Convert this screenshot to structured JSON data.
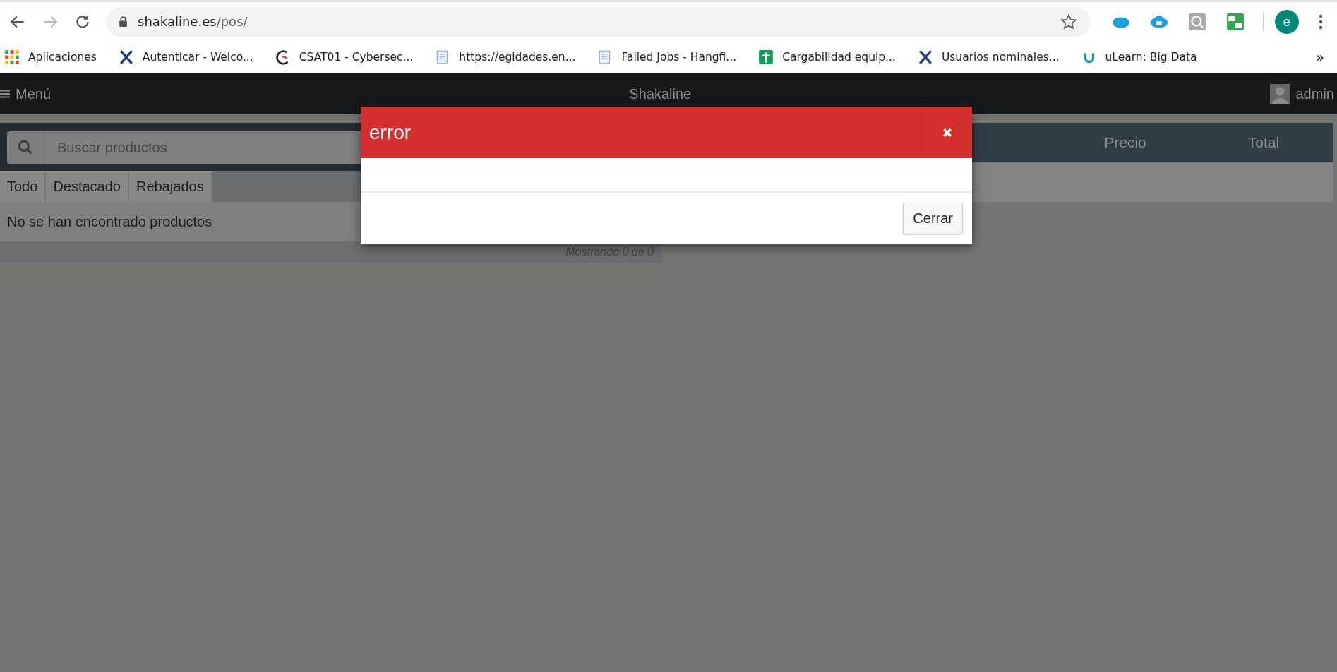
{
  "browser": {
    "url_host": "shakaline.es",
    "url_path": "/pos/",
    "profile_initial": "e",
    "overflow": "»",
    "bookmarks": [
      {
        "label": "Aplicaciones",
        "kind": "apps"
      },
      {
        "label": "Autenticar - Welco...",
        "kind": "cross"
      },
      {
        "label": "CSAT01 - Cybersec...",
        "kind": "ring"
      },
      {
        "label": "https://egidades.en...",
        "kind": "doc"
      },
      {
        "label": "Failed Jobs - Hangfi...",
        "kind": "doc"
      },
      {
        "label": "Cargabilidad equip...",
        "kind": "sheet"
      },
      {
        "label": "Usuarios nominales...",
        "kind": "cross"
      },
      {
        "label": "uLearn: Big Data",
        "kind": "letter"
      }
    ]
  },
  "app": {
    "menu_label": "Menú",
    "title": "Shakaline",
    "user": "admin"
  },
  "search": {
    "placeholder": "Buscar productos"
  },
  "tabs": [
    {
      "label": "Todo",
      "selected": false
    },
    {
      "label": "Destacado",
      "selected": false
    },
    {
      "label": "Rebajados",
      "selected": false
    }
  ],
  "empty_message": "No se han encontrado productos",
  "footer_count": "Mostrando 0 de 0",
  "order_table": {
    "columns": [
      "Precio",
      "Total"
    ]
  },
  "dialog": {
    "title": "error",
    "buttons": [
      "Cerrar"
    ]
  }
}
